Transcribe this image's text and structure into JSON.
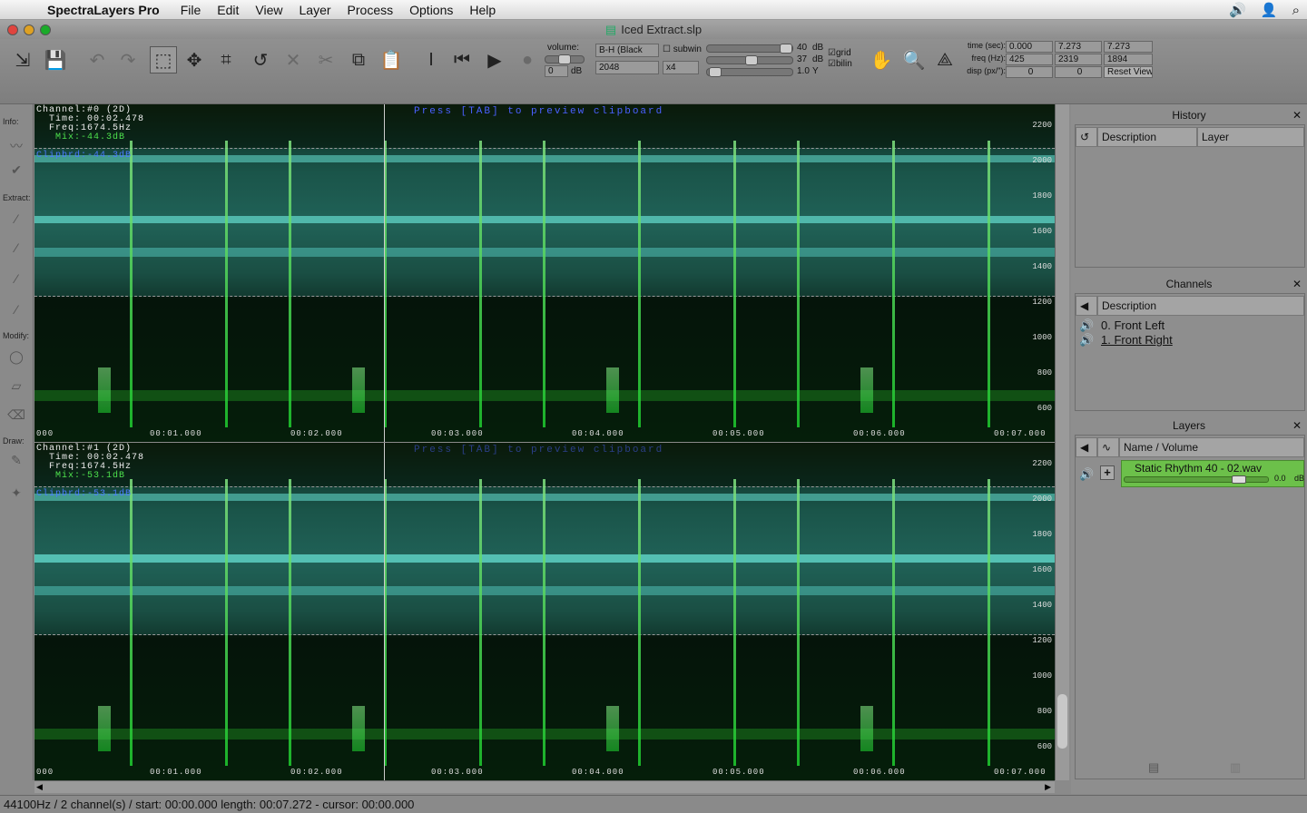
{
  "menubar": {
    "app_name": "SpectraLayers Pro",
    "items": [
      "File",
      "Edit",
      "View",
      "Layer",
      "Process",
      "Options",
      "Help"
    ]
  },
  "window": {
    "title": "Iced Extract.slp"
  },
  "toolbar": {
    "volume_label": "volume:",
    "volume_value": "0",
    "volume_unit": "dB",
    "window_type": "B-H (Black",
    "fft_size": "2048",
    "subwin_label": "subwin",
    "subwin_value": "x4",
    "range_db_top": "40",
    "range_db_mid": "37",
    "range_y": "1.0",
    "unit_db": "dB",
    "unit_y": "Y",
    "grid_label": "grid",
    "bilin_label": "bilin",
    "time_label": "time (sec):",
    "freq_label": "freq (Hz):",
    "disp_label": "disp (px/\"):",
    "time_start": "0.000",
    "time_end": "7.273",
    "time_len": "7.273",
    "freq_low": "425",
    "freq_high": "2319",
    "freq_span": "1894",
    "disp_x": "0",
    "disp_y": "0",
    "reset_view": "Reset View"
  },
  "left_tools": {
    "info_label": "Info:",
    "extract_label": "Extract:",
    "modify_label": "Modify:",
    "draw_label": "Draw:"
  },
  "channel0": {
    "line1": "Channel:#0 (2D)",
    "line2": "  Time: 00:02.478",
    "line3": "  Freq:1674.5Hz",
    "mix": "   Mix:-44.3dB",
    "clip": "Clipbrd:-44.3dB",
    "press": "Press [TAB] to preview clipboard"
  },
  "channel1": {
    "line1": "Channel:#1 (2D)",
    "line2": "  Time: 00:02.478",
    "line3": "  Freq:1674.5Hz",
    "mix": "   Mix:-53.1dB",
    "clip": "Clipbrd:-53.1dB",
    "press": "Press [TAB] to preview clipboard"
  },
  "time_ticks": [
    "000",
    "00:01.000",
    "00:02.000",
    "00:03.000",
    "00:04.000",
    "00:05.000",
    "00:06.000",
    "00:07.000"
  ],
  "freq_ticks": [
    "2200",
    "2000",
    "1800",
    "1600",
    "1400",
    "1200",
    "1000",
    "800",
    "600"
  ],
  "history": {
    "title": "History",
    "col_description": "Description",
    "col_layer": "Layer"
  },
  "channels": {
    "title": "Channels",
    "col_description": "Description",
    "items": [
      "0. Front Left",
      "1. Front Right"
    ]
  },
  "layers": {
    "title": "Layers",
    "col_name": "Name / Volume",
    "layer_name": "Static Rhythm 40 - 02.wav",
    "layer_volume": "0.0",
    "layer_unit": "dB",
    "layer_color": "#6cc04a"
  },
  "status": {
    "text": "44100Hz / 2 channel(s) / start: 00:00.000 length:  00:07.272 - cursor:  00:00.000"
  }
}
